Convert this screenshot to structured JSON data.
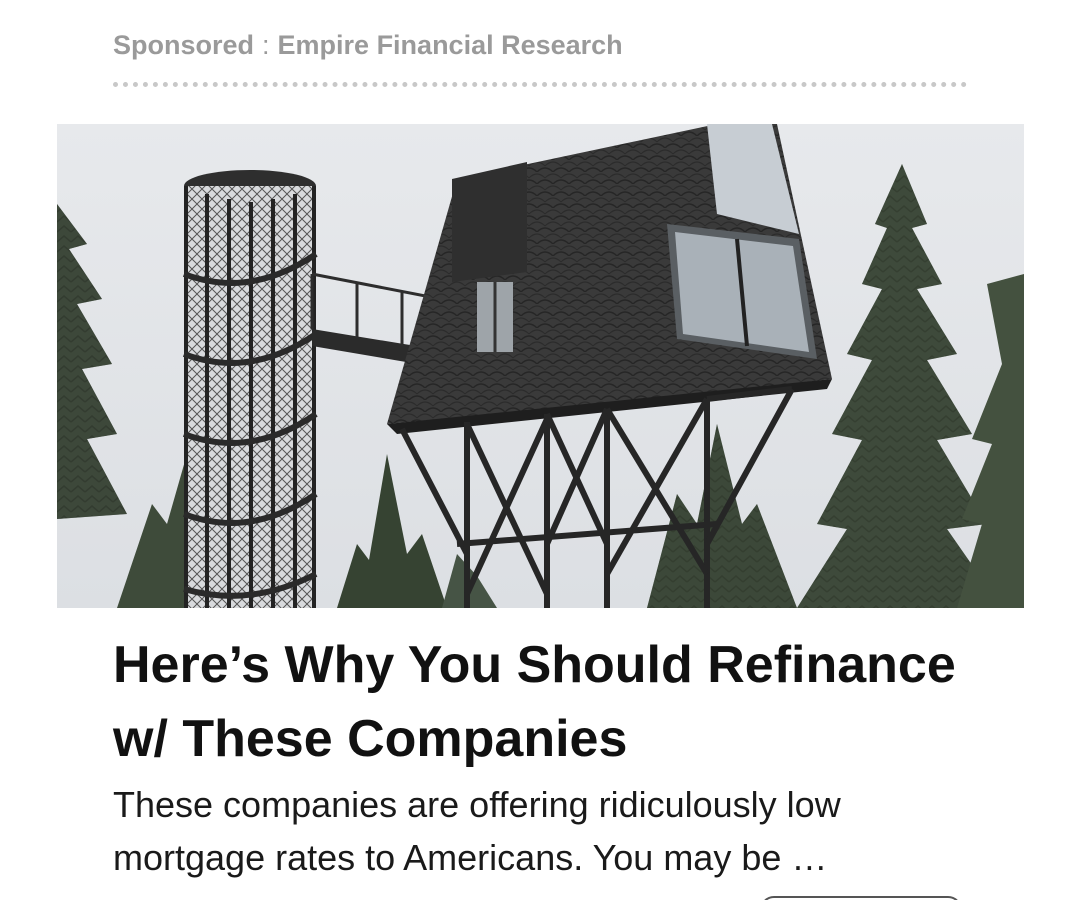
{
  "sponsor": {
    "label": "Sponsored",
    "separator": ":",
    "advertiser": "Empire Financial Research"
  },
  "article": {
    "headline": "Here’s Why You Should Refinance w/ These Companies",
    "description": "These companies are offering ridiculously low mortgage rates to Americans. You may be …"
  },
  "colors": {
    "sponsor_text": "#9a9a9a",
    "headline_text": "#111111",
    "body_text": "#1a1a1a",
    "divider": "#c8c8c8",
    "sky": "#e4e6e9"
  }
}
